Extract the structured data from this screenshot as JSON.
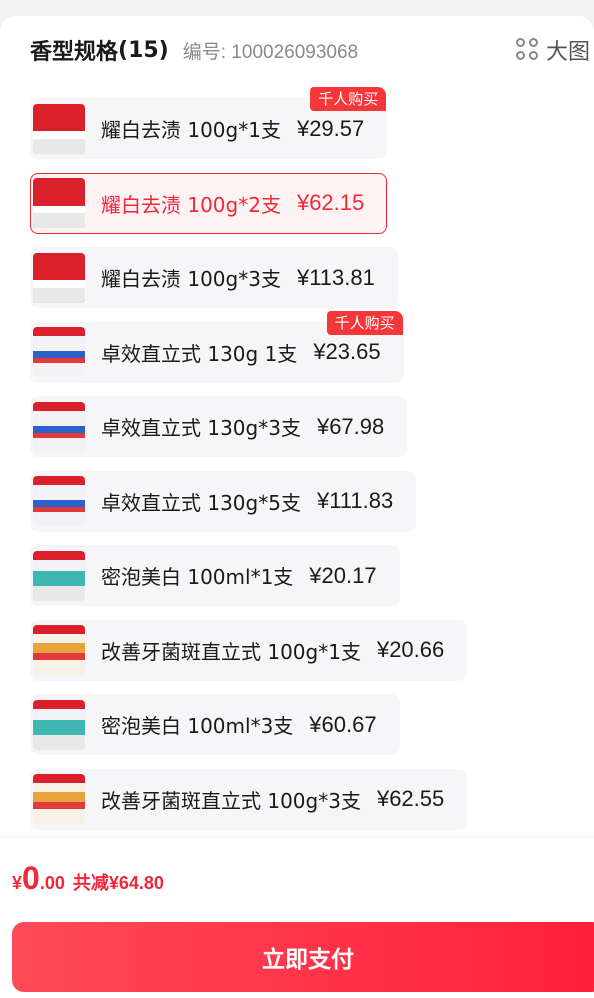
{
  "header": {
    "spec_title": "香型规格",
    "spec_count": "(15)",
    "sku_text": "编号: 100026093068",
    "bigview_label": "大图"
  },
  "items": [
    {
      "label": "耀白去渍 100g*1支",
      "price": "¥29.57",
      "badge": "千人购买",
      "selected": false,
      "thumb": "red-box-thumb"
    },
    {
      "label": "耀白去渍 100g*2支",
      "price": "¥62.15",
      "badge": "",
      "selected": true,
      "thumb": "red-box-thumb"
    },
    {
      "label": "耀白去渍 100g*3支",
      "price": "¥113.81",
      "badge": "",
      "selected": false,
      "thumb": "red-box-thumb"
    },
    {
      "label": "卓效直立式 130g 1支",
      "price": "¥23.65",
      "badge": "千人购买",
      "selected": false,
      "thumb": "white-box-thumb"
    },
    {
      "label": "卓效直立式 130g*3支",
      "price": "¥67.98",
      "badge": "",
      "selected": false,
      "thumb": "white-box-thumb"
    },
    {
      "label": "卓效直立式 130g*5支",
      "price": "¥111.83",
      "badge": "",
      "selected": false,
      "thumb": "white-box-thumb"
    },
    {
      "label": "密泡美白 100ml*1支",
      "price": "¥20.17",
      "badge": "",
      "selected": false,
      "thumb": "teal-box-thumb"
    },
    {
      "label": "改善牙菌斑直立式 100g*1支",
      "price": "¥20.66",
      "badge": "",
      "selected": false,
      "thumb": "cream-box-thumb"
    },
    {
      "label": "密泡美白 100ml*3支",
      "price": "¥60.67",
      "badge": "",
      "selected": false,
      "thumb": "teal-box-thumb"
    },
    {
      "label": "改善牙菌斑直立式 100g*3支",
      "price": "¥62.55",
      "badge": "",
      "selected": false,
      "thumb": "cream-box-thumb"
    }
  ],
  "footer": {
    "yen": "¥",
    "amount_int": "0",
    "amount_dec": ".00",
    "saved_text": "共减¥64.80",
    "pay_label": "立即支付"
  },
  "colors": {
    "accent": "#f0283c",
    "badge": "#f5373a",
    "pill_bg": "#f6f6f8"
  }
}
